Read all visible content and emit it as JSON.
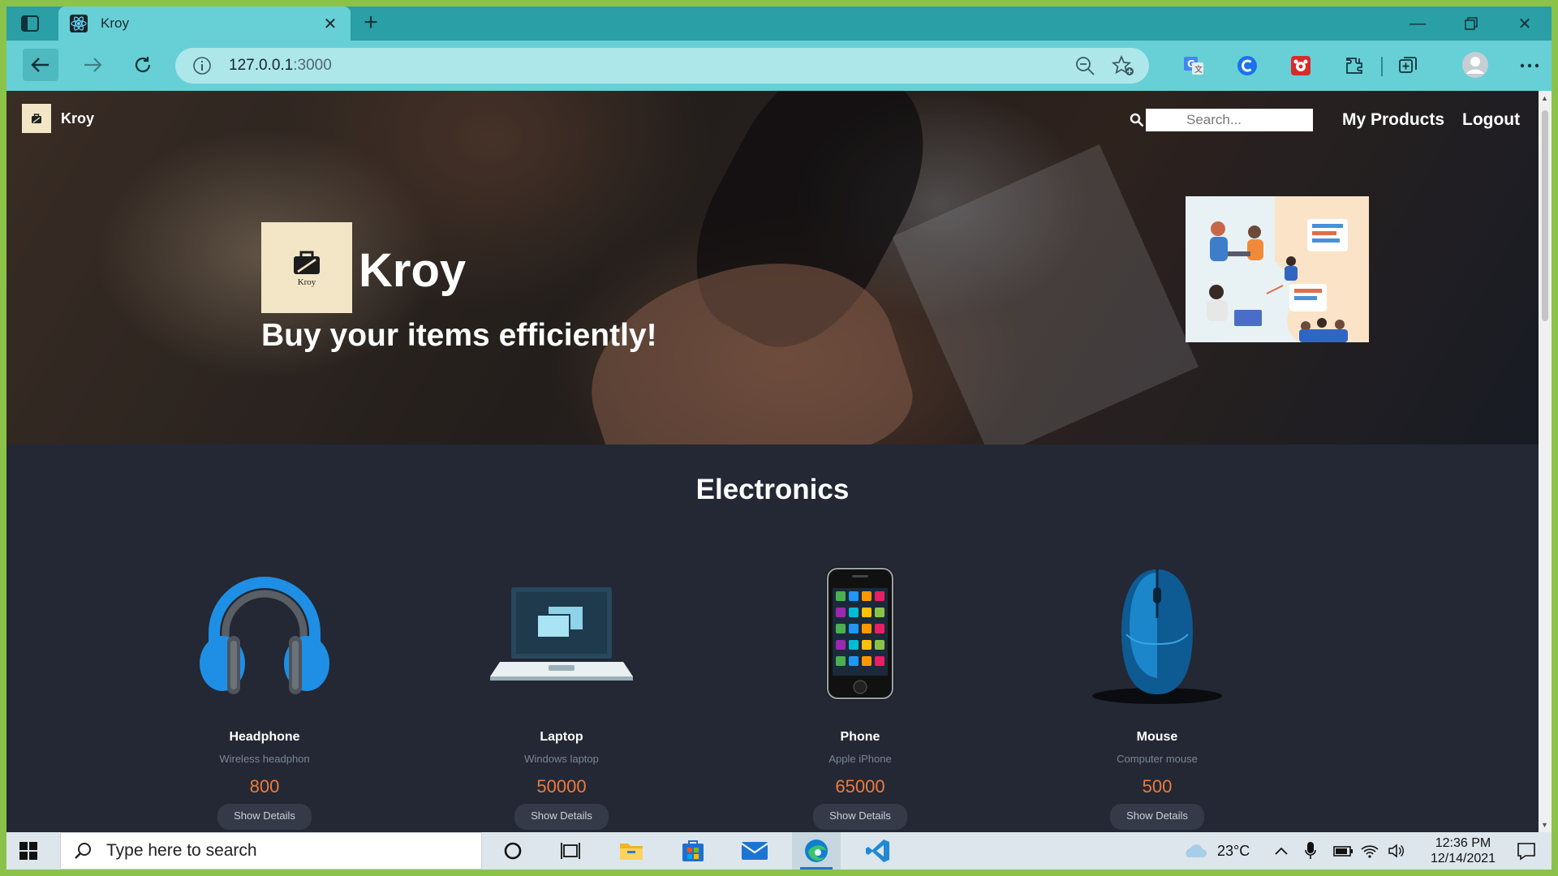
{
  "browser": {
    "tab_title": "Kroy",
    "url_host": "127.0.0.1",
    "url_port": ":3000"
  },
  "site": {
    "brand": "Kroy",
    "logo_caption": "Kroy",
    "search_placeholder": "Search...",
    "nav": [
      "My Products",
      "Logout"
    ],
    "hero_title": "Kroy",
    "hero_tagline": "Buy your items efficiently!"
  },
  "products": {
    "section_title": "Electronics",
    "button_label": "Show Details",
    "items": [
      {
        "name": "Headphone",
        "description": "Wireless headphon",
        "price": "800",
        "icon": "headphone-image"
      },
      {
        "name": "Laptop",
        "description": "Windows laptop",
        "price": "50000",
        "icon": "laptop-image"
      },
      {
        "name": "Phone",
        "description": "Apple iPhone",
        "price": "65000",
        "icon": "phone-image"
      },
      {
        "name": "Mouse",
        "description": "Computer mouse",
        "price": "500",
        "icon": "mouse-image"
      }
    ]
  },
  "taskbar": {
    "search_placeholder": "Type here to search",
    "weather": "23°C",
    "time": "12:36 PM",
    "date": "12/14/2021"
  },
  "colors": {
    "page_bg": "#232834",
    "price": "#f07a3a",
    "browser_accent": "#66d0d6",
    "frame_border": "#8bc34a"
  }
}
